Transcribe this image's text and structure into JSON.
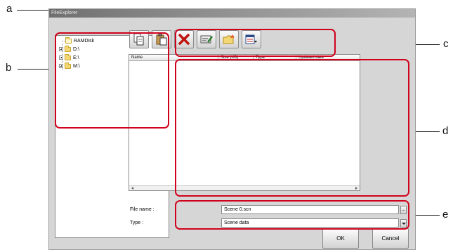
{
  "callouts": {
    "a": "a",
    "b": "b",
    "c": "c",
    "d": "d",
    "e": "e"
  },
  "window": {
    "title": "FileExplorer"
  },
  "tree": {
    "items": [
      {
        "label": "RAMDisk",
        "icon": "folder-open-icon"
      },
      {
        "label": "D:\\",
        "icon": "folder-icon"
      },
      {
        "label": "E:\\",
        "icon": "folder-icon"
      },
      {
        "label": "M:\\",
        "icon": "folder-icon"
      }
    ]
  },
  "toolbar": {
    "buttons": [
      {
        "icon": "copy-icon"
      },
      {
        "icon": "paste-icon"
      },
      {
        "icon": "delete-icon"
      },
      {
        "icon": "rename-icon"
      },
      {
        "icon": "new-folder-icon"
      },
      {
        "icon": "view-options-icon"
      }
    ]
  },
  "file_list": {
    "columns": [
      "Name",
      "Size (KB)",
      "Type",
      "Updated date"
    ]
  },
  "form": {
    "file_name_label": "File name :",
    "file_name_value": "Scene 0.scn",
    "browse_label": "...",
    "type_label": "Type :",
    "type_value": "Scene data"
  },
  "buttons": {
    "ok": "OK",
    "cancel": "Cancel"
  },
  "colors": {
    "highlight": "#d0021b",
    "window_bg": "#d6d6d6"
  }
}
